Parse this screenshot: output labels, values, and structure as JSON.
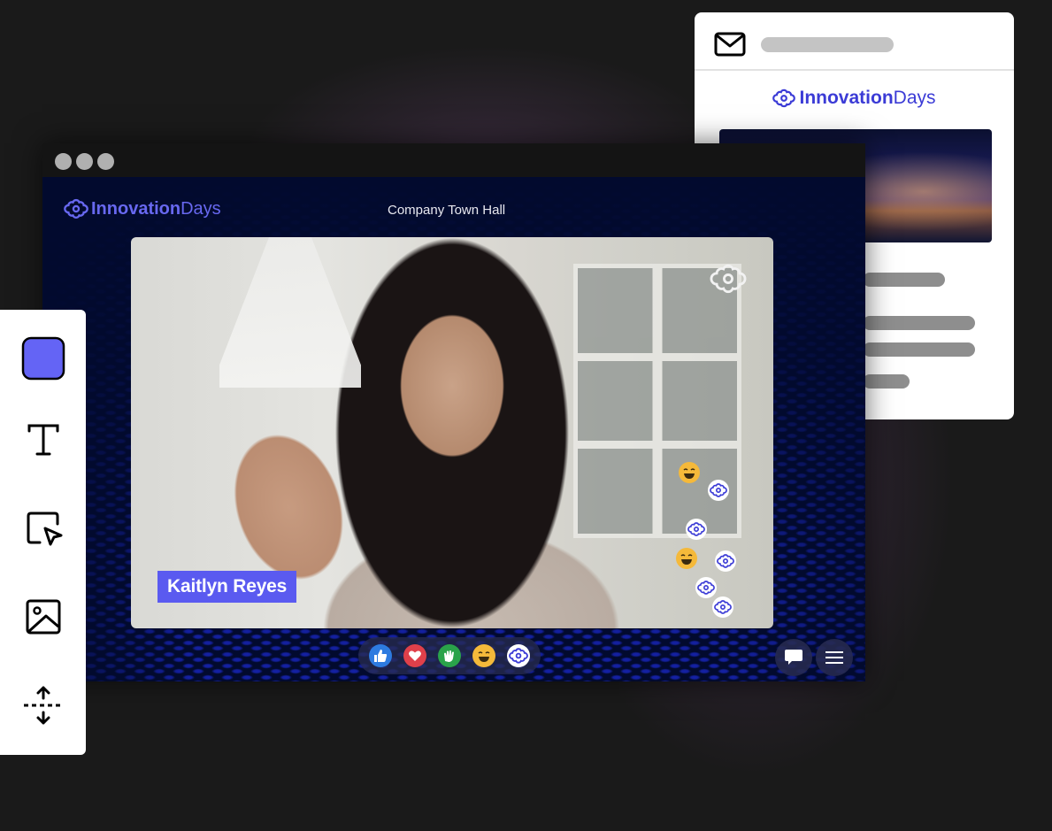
{
  "colors": {
    "brand_accent": "#5a5af0",
    "brand_text": "#3b3bd6",
    "stage_bg": "#020a2e",
    "like": "#2d7be0",
    "heart": "#e0404a",
    "clap": "#2aa34a",
    "smile": "#f5b93a"
  },
  "window": {
    "controls": [
      "window-dot",
      "window-dot",
      "window-dot"
    ]
  },
  "stage": {
    "logo": {
      "icon": "flower-logo-icon",
      "bold": "Innovation",
      "light": "Days"
    },
    "title": "Company Town Hall",
    "speaker_name": "Kaitlyn Reyes",
    "watermark_icon": "flower-logo-icon",
    "floating_reactions": [
      "smile",
      "flower",
      "flower",
      "smile",
      "flower",
      "flower",
      "flower"
    ]
  },
  "reactions": [
    {
      "name": "like",
      "icon": "thumbs-up-icon"
    },
    {
      "name": "love",
      "icon": "heart-icon"
    },
    {
      "name": "clap",
      "icon": "clapping-hands-icon"
    },
    {
      "name": "smile",
      "icon": "grinning-face-icon"
    },
    {
      "name": "brand",
      "icon": "flower-logo-icon"
    }
  ],
  "controls": {
    "chat_icon": "chat-bubble-icon",
    "menu_icon": "hamburger-menu-icon"
  },
  "email": {
    "header_icon": "mail-icon",
    "logo": {
      "bold": "Innovation",
      "light": "Days"
    }
  },
  "toolbar": {
    "tools": [
      {
        "name": "shape",
        "icon": "square-shape-icon"
      },
      {
        "name": "text",
        "icon": "text-icon"
      },
      {
        "name": "select",
        "icon": "select-cursor-icon"
      },
      {
        "name": "image",
        "icon": "image-icon"
      },
      {
        "name": "spacing",
        "icon": "vertical-resize-icon"
      }
    ]
  }
}
